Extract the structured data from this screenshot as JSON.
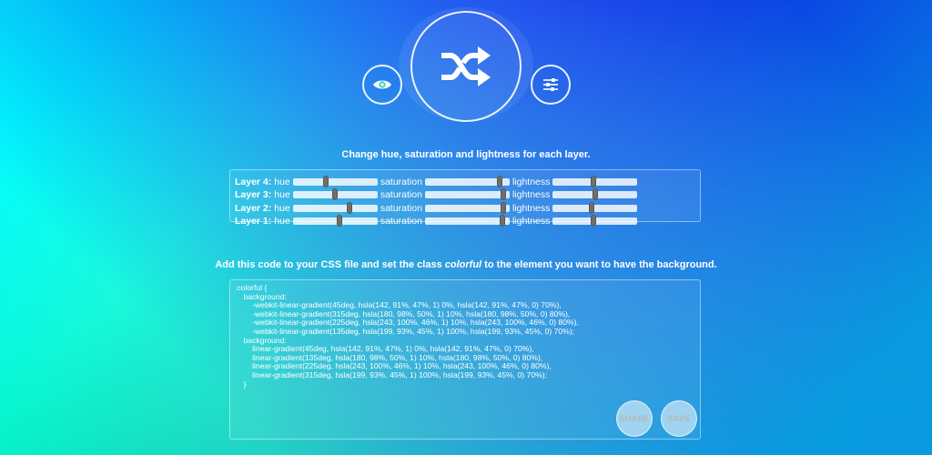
{
  "header": {
    "icons": [
      "shuffle-icon",
      "eye-icon",
      "sliders-icon"
    ]
  },
  "layers_section": {
    "heading": "Change hue, saturation and lightness for each layer.",
    "controls": {
      "hue": "hue",
      "saturation": "saturation",
      "lightness": "lightness"
    },
    "layers": [
      {
        "label": "Layer 4:",
        "hue": 0.39,
        "saturation": 0.88,
        "lightness": 0.48
      },
      {
        "label": "Layer 3:",
        "hue": 0.5,
        "saturation": 0.93,
        "lightness": 0.5
      },
      {
        "label": "Layer 2:",
        "hue": 0.67,
        "saturation": 0.93,
        "lightness": 0.46
      },
      {
        "label": "Layer 1:",
        "hue": 0.55,
        "saturation": 0.91,
        "lightness": 0.48
      }
    ]
  },
  "code_section": {
    "heading_before": "Add this code to your CSS file and set the class ",
    "heading_class": "colorful",
    "heading_after": " to the element you want to have the background.",
    "code": ".colorful {\n\tbackground:\n\t\t-webkit-linear-gradient(45deg, hsla(142, 91%, 47%, 1) 0%, hsla(142, 91%, 47%, 0) 70%),\n\t\t-webkit-linear-gradient(315deg, hsla(180, 98%, 50%, 1) 10%, hsla(180, 98%, 50%, 0) 80%),\n\t\t-webkit-linear-gradient(225deg, hsla(243, 100%, 46%, 1) 10%, hsla(243, 100%, 46%, 0) 80%),\n\t\t-webkit-linear-gradient(135deg, hsla(199, 93%, 45%, 1) 100%, hsla(199, 93%, 45%, 0) 70%);\n\tbackground:\n\t\tlinear-gradient(45deg, hsla(142, 91%, 47%, 1) 0%, hsla(142, 91%, 47%, 0) 70%),\n\t\tlinear-gradient(135deg, hsla(180, 98%, 50%, 1) 10%, hsla(180, 98%, 50%, 0) 80%),\n\t\tlinear-gradient(225deg, hsla(243, 100%, 46%, 1) 10%, hsla(243, 100%, 46%, 0) 80%),\n\t\tlinear-gradient(315deg, hsla(199, 93%, 45%, 1) 100%, hsla(199, 93%, 45%, 0) 70%);\n\t}",
    "share_label": "SHARE",
    "save_label": "SAVE"
  }
}
